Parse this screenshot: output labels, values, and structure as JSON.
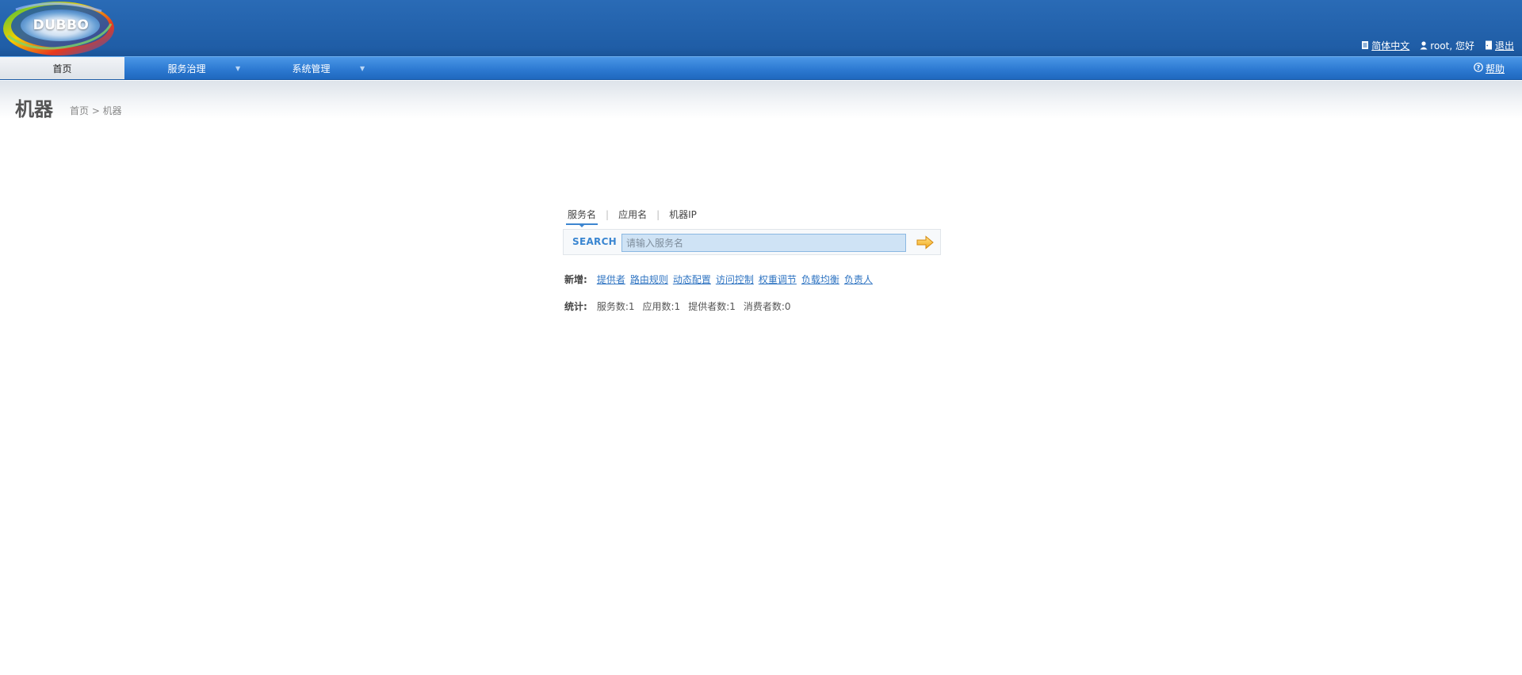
{
  "header": {
    "logo_text": "DUBBO",
    "language": "简体中文",
    "user_greeting": "root, 您好",
    "logout": "退出"
  },
  "nav": {
    "items": [
      {
        "label": "首页",
        "active": true
      },
      {
        "label": "服务治理",
        "has_dropdown": true
      },
      {
        "label": "系统管理",
        "has_dropdown": true
      }
    ],
    "help": "帮助"
  },
  "page": {
    "title": "机器",
    "breadcrumb": "首页 > 机器"
  },
  "search": {
    "tabs": [
      "服务名",
      "应用名",
      "机器IP"
    ],
    "active_tab": "服务名",
    "label": "SEARCH",
    "placeholder": "请输入服务名",
    "value": ""
  },
  "add": {
    "label": "新增:",
    "links": [
      "提供者",
      "路由规则",
      "动态配置",
      "访问控制",
      "权重调节",
      "负载均衡",
      "负责人"
    ]
  },
  "stats": {
    "label": "统计:",
    "items": [
      "服务数:1",
      "应用数:1",
      "提供者数:1",
      "消费者数:0"
    ]
  },
  "colors": {
    "header_bg": "#2166b0",
    "nav_bg": "#2d7ad2",
    "link": "#2f74c2",
    "accent": "#3a86d1"
  }
}
